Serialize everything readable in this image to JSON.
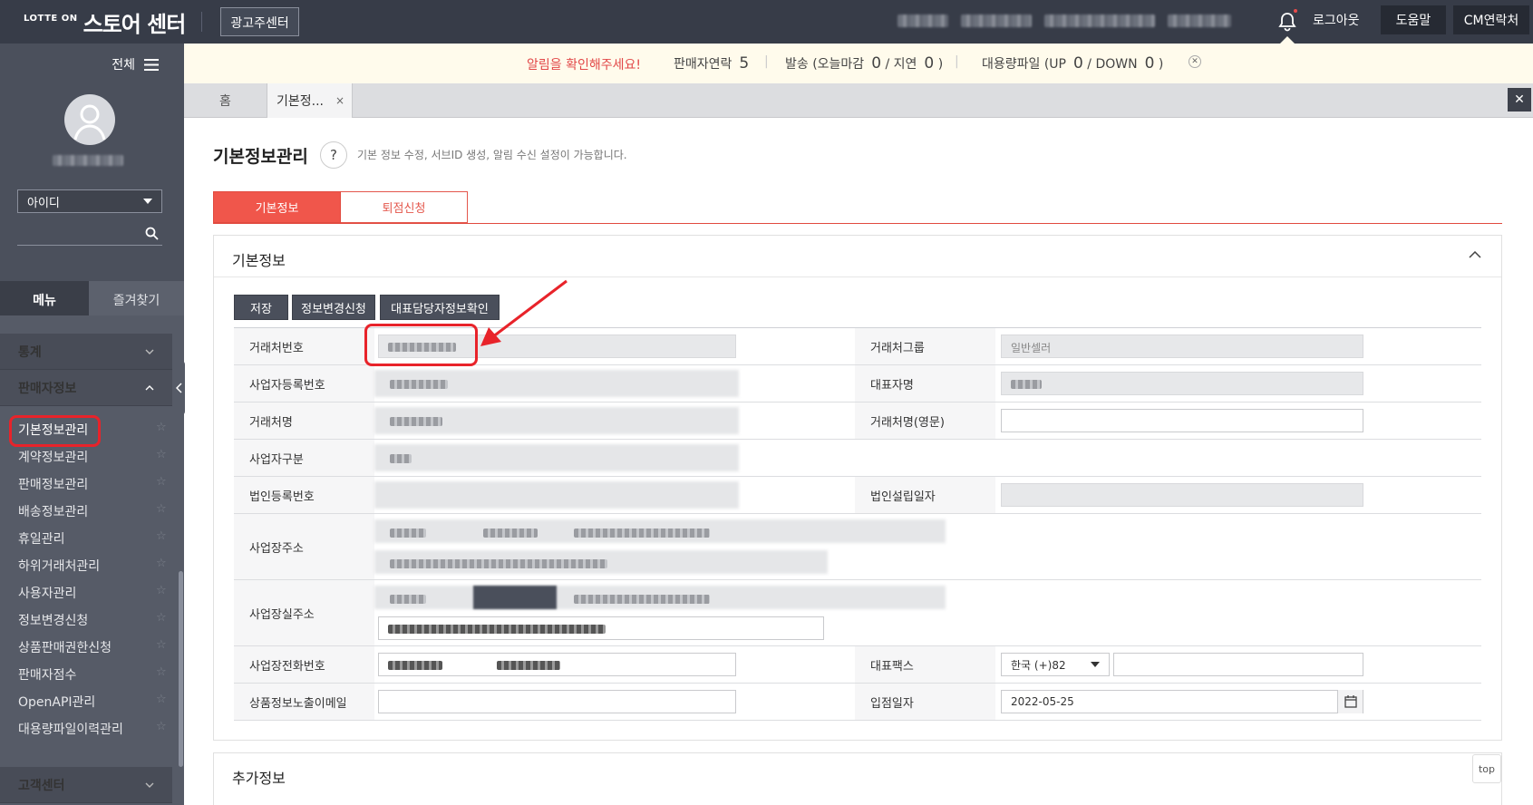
{
  "header": {
    "logo_small": "LOTTE ON",
    "logo_title": "스토어 센터",
    "ad_center_label": "광고주센터",
    "logout_label": "로그아웃",
    "help_label": "도움말",
    "cm_contact_label": "CM연락처"
  },
  "sidebar": {
    "all_label": "전체",
    "id_select_value": "아이디",
    "tab_menu": "메뉴",
    "tab_favorites": "즐겨찾기",
    "sections": [
      {
        "label": "통계"
      },
      {
        "label": "판매자정보"
      },
      {
        "label": "고객센터"
      }
    ],
    "items": [
      {
        "label": "기본정보관리"
      },
      {
        "label": "계약정보관리"
      },
      {
        "label": "판매정보관리"
      },
      {
        "label": "배송정보관리"
      },
      {
        "label": "휴일관리"
      },
      {
        "label": "하위거래처관리"
      },
      {
        "label": "사용자관리"
      },
      {
        "label": "정보변경신청"
      },
      {
        "label": "상품판매권한신청"
      },
      {
        "label": "판매자점수"
      },
      {
        "label": "OpenAPI관리"
      },
      {
        "label": "대용량파일이력관리"
      }
    ]
  },
  "notice": {
    "alert": "알림을 확인해주세요!",
    "seller_contact_label": "판매자연락",
    "seller_contact_count": "5",
    "shipping_label": "발송 (오늘마감",
    "shipping_today": "0",
    "shipping_sep": "/ 지연",
    "shipping_delay": "0",
    "shipping_close": ")",
    "bulk_label": "대용량파일 (UP",
    "bulk_up": "0",
    "bulk_sep": "/ DOWN",
    "bulk_down": "0",
    "bulk_close": ")"
  },
  "tabs": {
    "home": "홈",
    "active": "기본정...",
    "close": "×"
  },
  "page": {
    "title": "기본정보관리",
    "help": "?",
    "description": "기본 정보 수정, 서브ID 생성, 알림 수신 설정이 가능합니다.",
    "subtabs": [
      "기본정보",
      "퇴점신청"
    ]
  },
  "panel": {
    "title": "기본정보",
    "buttons": {
      "save": "저장",
      "change_request": "정보변경신청",
      "rep_check": "대표담당자정보확인"
    },
    "fields": {
      "account_no": "거래처번호",
      "account_group": "거래처그룹",
      "account_group_value": "일반셀러",
      "biz_reg_no": "사업자등록번호",
      "ceo_name": "대표자명",
      "account_name": "거래처명",
      "account_name_en": "거래처명(영문)",
      "biz_type": "사업자구분",
      "corp_reg_no": "법인등록번호",
      "corp_date": "법인설립일자",
      "biz_address": "사업장주소",
      "biz_real_address": "사업장실주소",
      "biz_phone": "사업장전화번호",
      "rep_fax": "대표팩스",
      "fax_country": "한국 (+)82",
      "product_email": "상품정보노출이메일",
      "join_date": "입점일자",
      "join_date_value": "2022-05-25"
    }
  },
  "panel2": {
    "title": "추가정보"
  },
  "fab": {
    "top": "top"
  },
  "colors": {
    "accent": "#f0564b",
    "header_bg": "#373c48",
    "sidebar_bg": "#565b67",
    "annotation": "#e8232a"
  }
}
